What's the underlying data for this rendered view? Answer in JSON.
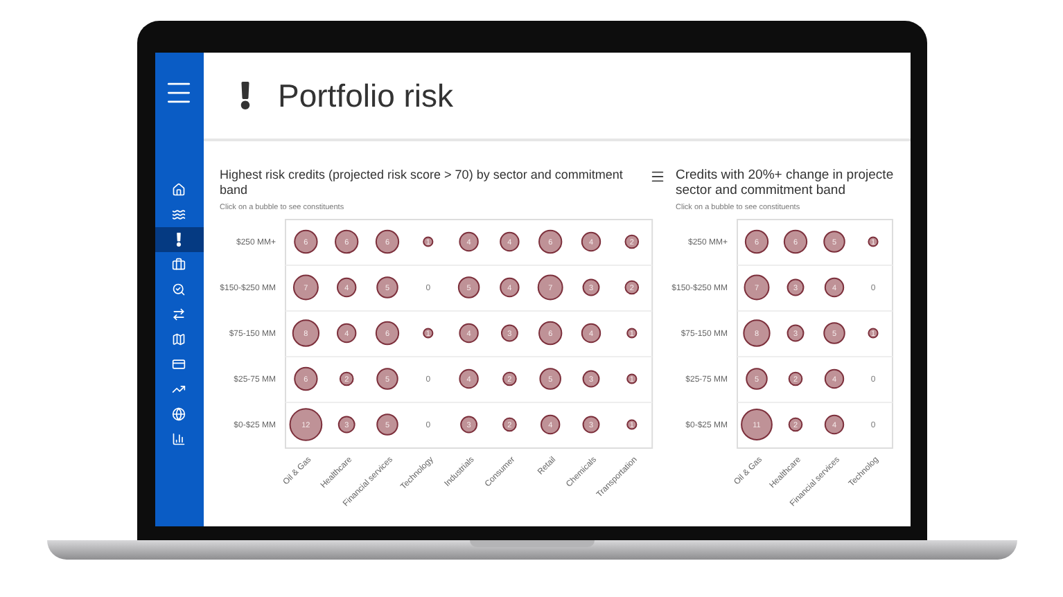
{
  "sidebar": {
    "items": [
      {
        "selected": false
      },
      {
        "selected": false
      },
      {
        "selected": true
      },
      {
        "selected": false
      },
      {
        "selected": false
      },
      {
        "selected": false
      },
      {
        "selected": false
      },
      {
        "selected": false
      },
      {
        "selected": false
      },
      {
        "selected": false
      },
      {
        "selected": false
      }
    ]
  },
  "page": {
    "title": "Portfolio risk"
  },
  "charts": [
    {
      "title": "Highest risk credits (projected risk score > 70) by sector and commitment band",
      "subtitle": "Click on a bubble to see constituents",
      "columns": [
        "Oil & Gas",
        "Healthcare",
        "Financial services",
        "Technology",
        "Industrials",
        "Consumer",
        "Retail",
        "Chemicals",
        "Transportation"
      ],
      "rows": [
        {
          "label": "$250 MM+",
          "values": [
            "6",
            "6",
            "6",
            "1",
            "4",
            "4",
            "6",
            "4",
            "2"
          ]
        },
        {
          "label": "$150-$250 MM",
          "values": [
            "7",
            "4",
            "5",
            "0",
            "5",
            "4",
            "7",
            "3",
            "2"
          ]
        },
        {
          "label": "$75-150 MM",
          "values": [
            "8",
            "4",
            "6",
            "1",
            "4",
            "3",
            "6",
            "4",
            "1"
          ]
        },
        {
          "label": "$25-75 MM",
          "values": [
            "6",
            "2",
            "5",
            "0",
            "4",
            "2",
            "5",
            "3",
            "1"
          ]
        },
        {
          "label": "$0-$25 MM",
          "values": [
            "12",
            "3",
            "5",
            "0",
            "3",
            "2",
            "4",
            "3",
            "1"
          ]
        }
      ]
    },
    {
      "title": "Credits with 20%+ change in projecte sector and commitment band",
      "subtitle": "Click on a bubble to see constituents",
      "columns": [
        "Oil & Gas",
        "Healthcare",
        "Financial services",
        "Technolog"
      ],
      "rows": [
        {
          "label": "$250 MM+",
          "values": [
            "6",
            "6",
            "5",
            "1"
          ]
        },
        {
          "label": "$150-$250 MM",
          "values": [
            "7",
            "3",
            "4",
            "0"
          ]
        },
        {
          "label": "$75-150 MM",
          "values": [
            "8",
            "3",
            "5",
            "1"
          ]
        },
        {
          "label": "$25-75 MM",
          "values": [
            "5",
            "2",
            "4",
            "0"
          ]
        },
        {
          "label": "$0-$25 MM",
          "values": [
            "11",
            "2",
            "4",
            "0"
          ]
        }
      ]
    }
  ]
}
